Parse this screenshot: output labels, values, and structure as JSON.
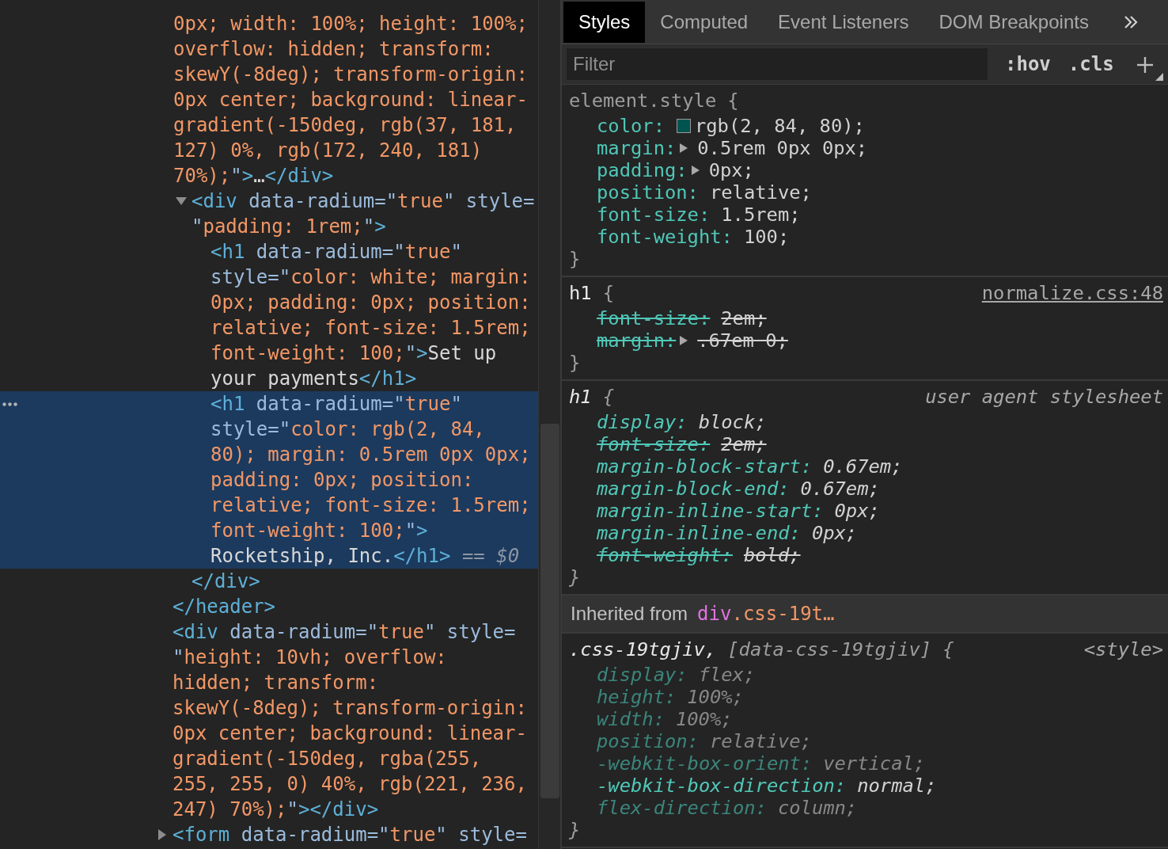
{
  "elements_tree": [
    {
      "kind": "node",
      "selected": false,
      "closing_tag": "</header>",
      "children": [
        {
          "kind": "partial",
          "selected": false,
          "parts": [
            {
              "kind": "value",
              "text": "0px; width: 100%; height: 100%; overflow: hidden; transform: skewY(-8deg); transform-origin: 0px center; background: linear-gradient(-150deg, rgb(37, 181, 127) 0%, rgb(172, 240, 181) 70%);"
            },
            {
              "kind": "quote",
              "text": "\""
            },
            {
              "kind": "tag",
              "text": ">"
            },
            {
              "kind": "text",
              "text": "…"
            },
            {
              "kind": "tag",
              "text": "</div>"
            }
          ]
        },
        {
          "kind": "node",
          "selected": false,
          "expanded": true,
          "parts": [
            {
              "kind": "tag",
              "text": "<div"
            },
            {
              "kind": "attr_name",
              "text": " data-radium="
            },
            {
              "kind": "quote",
              "text": "\""
            },
            {
              "kind": "value",
              "text": "true"
            },
            {
              "kind": "quote",
              "text": "\""
            },
            {
              "kind": "attr_name",
              "text": " style="
            },
            {
              "kind": "quote",
              "text": "\""
            },
            {
              "kind": "value",
              "text": "padding: 1rem;"
            },
            {
              "kind": "quote",
              "text": "\""
            },
            {
              "kind": "tag",
              "text": ">"
            }
          ],
          "closing_tag": "</div>",
          "children": [
            {
              "kind": "node",
              "selected": false,
              "parts": [
                {
                  "kind": "tag",
                  "text": "<h1"
                },
                {
                  "kind": "attr_name",
                  "text": " data-radium="
                },
                {
                  "kind": "quote",
                  "text": "\""
                },
                {
                  "kind": "value",
                  "text": "true"
                },
                {
                  "kind": "quote",
                  "text": "\""
                },
                {
                  "kind": "attr_name",
                  "text": " style="
                },
                {
                  "kind": "quote",
                  "text": "\""
                },
                {
                  "kind": "value",
                  "text": "color: white; margin: 0px; padding: 0px; position: relative; font-size: 1.5rem; font-weight: 100;"
                },
                {
                  "kind": "quote",
                  "text": "\""
                },
                {
                  "kind": "tag",
                  "text": ">"
                },
                {
                  "kind": "text",
                  "text": "Set up your payments"
                },
                {
                  "kind": "tag",
                  "text": "</h1>"
                }
              ]
            },
            {
              "kind": "node",
              "selected": true,
              "parts": [
                {
                  "kind": "tag",
                  "text": "<h1"
                },
                {
                  "kind": "attr_name",
                  "text": " data-radium="
                },
                {
                  "kind": "quote",
                  "text": "\""
                },
                {
                  "kind": "value",
                  "text": "true"
                },
                {
                  "kind": "quote",
                  "text": "\""
                },
                {
                  "kind": "attr_name",
                  "text": " style="
                },
                {
                  "kind": "quote",
                  "text": "\""
                },
                {
                  "kind": "value",
                  "text": "color: rgb(2, 84, 80); margin: 0.5rem 0px 0px; padding: 0px; position: relative; font-size: 1.5rem; font-weight: 100;"
                },
                {
                  "kind": "quote",
                  "text": "\""
                },
                {
                  "kind": "tag",
                  "text": ">"
                },
                {
                  "kind": "text",
                  "text": "Rocketship, Inc."
                },
                {
                  "kind": "tag",
                  "text": "</h1>"
                },
                {
                  "kind": "console",
                  "text": " == *$0*"
                }
              ]
            }
          ]
        }
      ]
    },
    {
      "kind": "node",
      "selected": false,
      "parts": [
        {
          "kind": "tag",
          "text": "<div"
        },
        {
          "kind": "attr_name",
          "text": " data-radium="
        },
        {
          "kind": "quote",
          "text": "\""
        },
        {
          "kind": "value",
          "text": "true"
        },
        {
          "kind": "quote",
          "text": "\""
        },
        {
          "kind": "attr_name",
          "text": " style="
        },
        {
          "kind": "quote",
          "text": "\""
        },
        {
          "kind": "value",
          "text": "height: 10vh; overflow: hidden; transform: skewY(-8deg); transform-origin: 0px center; background: linear-gradient(-150deg, rgba(255, 255, 255, 0) 40%, rgb(221, 236, 247) 70%);"
        },
        {
          "kind": "quote",
          "text": "\""
        },
        {
          "kind": "tag",
          "text": ">"
        },
        {
          "kind": "tag",
          "text": "</div>"
        }
      ]
    },
    {
      "kind": "node",
      "selected": false,
      "expanded": false,
      "parts": [
        {
          "kind": "tag",
          "text": "<form"
        },
        {
          "kind": "attr_name",
          "text": " data-radium="
        },
        {
          "kind": "quote",
          "text": "\""
        },
        {
          "kind": "value",
          "text": "true"
        },
        {
          "kind": "quote",
          "text": "\""
        },
        {
          "kind": "attr_name",
          "text": " style="
        }
      ]
    }
  ],
  "tabs": [
    {
      "label": "Styles",
      "selected": true
    },
    {
      "label": "Computed",
      "selected": false
    },
    {
      "label": "Event Listeners",
      "selected": false
    },
    {
      "label": "DOM Breakpoints",
      "selected": false
    }
  ],
  "filter_bar": {
    "placeholder": "Filter",
    "toggles": [
      ":hov",
      ".cls"
    ]
  },
  "style_rules": [
    {
      "selector": [
        {
          "text": "element.style",
          "matched": false
        }
      ],
      "open_brace": "{",
      "close_brace": "}",
      "editable": true,
      "declarations": [
        {
          "property": "color:",
          "value": "rgb(2, 84, 80);",
          "color": "#025450",
          "overridden": false
        },
        {
          "property": "margin:",
          "value": "0.5rem 0px 0px;",
          "expanded": false,
          "overridden": false
        },
        {
          "property": "padding:",
          "value": "0px;",
          "expanded": false,
          "overridden": false
        },
        {
          "property": "position:",
          "value": "relative;",
          "overridden": false
        },
        {
          "property": "font-size:",
          "value": "1.5rem;",
          "overridden": false
        },
        {
          "property": "font-weight:",
          "value": "100;",
          "overridden": false
        }
      ]
    },
    {
      "selector": [
        {
          "text": "h1",
          "matched": true
        }
      ],
      "open_brace": "{",
      "close_brace": "}",
      "source": {
        "kind": "link",
        "text": "normalize.css:48"
      },
      "editable": true,
      "declarations": [
        {
          "property": "font-size:",
          "value": "2em;",
          "overridden": true
        },
        {
          "property": "margin:",
          "value": ".67em 0;",
          "expanded": false,
          "overridden": true
        }
      ]
    },
    {
      "selector": [
        {
          "text": "h1",
          "matched": true
        }
      ],
      "open_brace": "{",
      "close_brace": "}",
      "source": {
        "kind": "plain",
        "text": "user agent stylesheet"
      },
      "editable": false,
      "declarations": [
        {
          "property": "display:",
          "value": "block;",
          "overridden": false
        },
        {
          "property": "font-size:",
          "value": "2em;",
          "overridden": true
        },
        {
          "property": "margin-block-start:",
          "value": "0.67em;",
          "overridden": false
        },
        {
          "property": "margin-block-end:",
          "value": "0.67em;",
          "overridden": false
        },
        {
          "property": "margin-inline-start:",
          "value": "0px;",
          "overridden": false
        },
        {
          "property": "margin-inline-end:",
          "value": "0px;",
          "overridden": false
        },
        {
          "property": "font-weight:",
          "value": "bold;",
          "overridden": true
        }
      ]
    }
  ],
  "inherited_from": {
    "label": "Inherited from",
    "tag": "div",
    "class_name": ".css-19t…"
  },
  "inherited_rules": [
    {
      "selector": [
        {
          "text": ".css-19tgjiv,",
          "matched": true
        },
        {
          "text": "[data-css-19tgjiv]",
          "matched": false
        }
      ],
      "open_brace": "{",
      "close_brace": "}",
      "source": {
        "kind": "plain",
        "text": "<style>"
      },
      "editable": false,
      "declarations": [
        {
          "property": "display:",
          "value": "flex;",
          "overridden": false,
          "inherited": false
        },
        {
          "property": "height:",
          "value": "100%;",
          "overridden": false,
          "inherited": false
        },
        {
          "property": "width:",
          "value": "100%;",
          "overridden": false,
          "inherited": false
        },
        {
          "property": "position:",
          "value": "relative;",
          "overridden": false,
          "inherited": false
        },
        {
          "property": "-webkit-box-orient:",
          "value": "vertical;",
          "overridden": false,
          "inherited": false
        },
        {
          "property": "-webkit-box-direction:",
          "value": "normal;",
          "overridden": false,
          "inherited": true
        },
        {
          "property": "flex-direction:",
          "value": "column;",
          "overridden": false,
          "inherited": false
        }
      ]
    }
  ]
}
